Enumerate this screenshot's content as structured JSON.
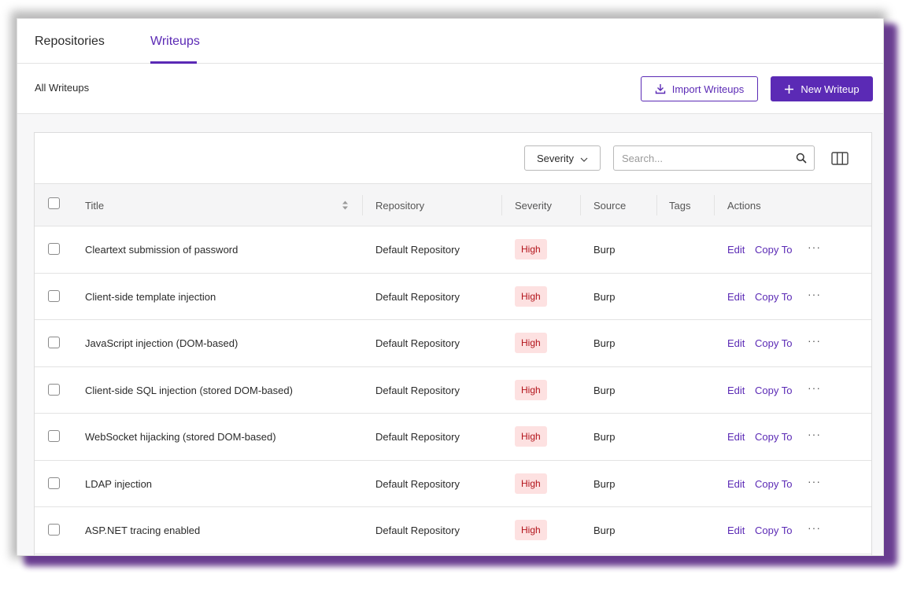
{
  "tabs": [
    {
      "label": "Repositories",
      "active": false
    },
    {
      "label": "Writeups",
      "active": true
    }
  ],
  "subheader": {
    "title": "All Writeups",
    "import_label": "Import Writeups",
    "new_label": "New Writeup"
  },
  "toolbar": {
    "severity_filter_label": "Severity",
    "search_placeholder": "Search..."
  },
  "table": {
    "columns": [
      "Title",
      "Repository",
      "Severity",
      "Source",
      "Tags",
      "Actions"
    ],
    "rows": [
      {
        "title": "Cleartext submission of password",
        "repository": "Default Repository",
        "severity": "High",
        "source": "Burp",
        "tags": ""
      },
      {
        "title": "Client-side template injection",
        "repository": "Default Repository",
        "severity": "High",
        "source": "Burp",
        "tags": ""
      },
      {
        "title": "JavaScript injection (DOM-based)",
        "repository": "Default Repository",
        "severity": "High",
        "source": "Burp",
        "tags": ""
      },
      {
        "title": "Client-side SQL injection (stored DOM-based)",
        "repository": "Default Repository",
        "severity": "High",
        "source": "Burp",
        "tags": ""
      },
      {
        "title": "WebSocket hijacking (stored DOM-based)",
        "repository": "Default Repository",
        "severity": "High",
        "source": "Burp",
        "tags": ""
      },
      {
        "title": "LDAP injection",
        "repository": "Default Repository",
        "severity": "High",
        "source": "Burp",
        "tags": ""
      },
      {
        "title": "ASP.NET tracing enabled",
        "repository": "Default Repository",
        "severity": "High",
        "source": "Burp",
        "tags": ""
      }
    ],
    "actions": {
      "edit": "Edit",
      "copy_to": "Copy To",
      "more": "···"
    }
  },
  "colors": {
    "accent": "#5b2ab5",
    "badge_bg": "#fde1e1",
    "badge_text": "#b3141b"
  },
  "icons": [
    "download-icon",
    "plus-icon",
    "chevron-down-icon",
    "search-icon",
    "columns-icon",
    "sort-icon",
    "more-icon"
  ]
}
